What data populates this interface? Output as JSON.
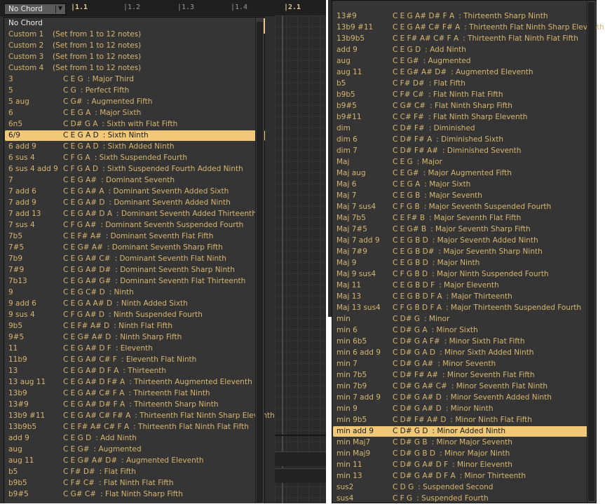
{
  "toolbar": {
    "chord_select_value": "No Chord",
    "ruler": [
      "|1.1",
      "|1.2",
      "|1.3",
      "|1.4",
      "|2.1"
    ]
  },
  "left_menu": {
    "items": [
      {
        "name": "No Chord",
        "notes": "",
        "desc": ""
      },
      {
        "name": "Custom 1",
        "notes": "(Set from 1 to 12 notes)",
        "desc": ""
      },
      {
        "name": "Custom 2",
        "notes": "(Set from 1 to 12 notes)",
        "desc": ""
      },
      {
        "name": "Custom 3",
        "notes": "(Set from 1 to 12 notes)",
        "desc": ""
      },
      {
        "name": "Custom 4",
        "notes": "(Set from 1 to 12 notes)",
        "desc": ""
      },
      {
        "name": "3",
        "notes": "C E G",
        "desc": ": Major Third"
      },
      {
        "name": "5",
        "notes": "C G",
        "desc": ": Perfect Fifth"
      },
      {
        "name": "5 aug",
        "notes": "C G#",
        "desc": ": Augmented Fifth"
      },
      {
        "name": "6",
        "notes": "C E G A",
        "desc": ": Major Sixth"
      },
      {
        "name": "6n5",
        "notes": "C D# G A",
        "desc": ": Sixth with Flat Fifth"
      },
      {
        "name": "6/9",
        "notes": "C E G A D",
        "desc": ": Sixth Ninth"
      },
      {
        "name": "6 add 9",
        "notes": "C E G A D",
        "desc": ": Sixth Added Ninth"
      },
      {
        "name": "6 sus 4",
        "notes": "C F G A",
        "desc": ": Sixth Suspended Fourth"
      },
      {
        "name": "6 sus 4 add 9",
        "notes": "C F G A D",
        "desc": ": Sixth Suspended Fourth Added Ninth"
      },
      {
        "name": "7",
        "notes": "C E G A#",
        "desc": ": Dominant Seventh"
      },
      {
        "name": "7 add 6",
        "notes": "C E G A# A",
        "desc": ": Dominant Seventh Added Sixth"
      },
      {
        "name": "7 add 9",
        "notes": "C E G A# D",
        "desc": ": Dominant Seventh Added Ninth"
      },
      {
        "name": "7 add 13",
        "notes": "C E G A# D A",
        "desc": ": Dominant Seventh Added Thirteenth"
      },
      {
        "name": "7 sus 4",
        "notes": "C F G A#",
        "desc": ": Dominant Seventh Suspended Fourth"
      },
      {
        "name": "7b5",
        "notes": "C E F# A#",
        "desc": ": Dominant Seventh Flat Fifth"
      },
      {
        "name": "7#5",
        "notes": "C E G# A#",
        "desc": ": Dominant Seventh Sharp Fifth"
      },
      {
        "name": "7b9",
        "notes": "C E G A# C#",
        "desc": ": Dominant Seventh Flat Ninth"
      },
      {
        "name": "7#9",
        "notes": "C E G A# D#",
        "desc": ": Dominant Seventh Sharp Ninth"
      },
      {
        "name": "7b13",
        "notes": "C E G A# G#",
        "desc": ": Dominant Seventh Flat Thirteenth"
      },
      {
        "name": "9",
        "notes": "C E G C# D",
        "desc": ": Ninth"
      },
      {
        "name": "9 add 6",
        "notes": "C E G A A# D",
        "desc": ": Ninth Added Sixth"
      },
      {
        "name": "9 sus 4",
        "notes": "C F G A# D",
        "desc": ": Ninth Suspended Fourth"
      },
      {
        "name": "9b5",
        "notes": "C E F# A# D",
        "desc": ": Ninth Flat Fifth"
      },
      {
        "name": "9#5",
        "notes": "C E G# A# D",
        "desc": ": Ninth Sharp Fifth"
      },
      {
        "name": "11",
        "notes": "C E G A# D F",
        "desc": ": Eleventh"
      },
      {
        "name": "11b9",
        "notes": "C E G A# C# F",
        "desc": ": Eleventh Flat Ninth"
      },
      {
        "name": "13",
        "notes": "C E G A# D F A",
        "desc": ": Thirteenth"
      },
      {
        "name": "13 aug 11",
        "notes": "C E G A# D F# A",
        "desc": ": Thirteenth Augmented Eleventh"
      },
      {
        "name": "13b9",
        "notes": "C E G A# C# F A",
        "desc": ": Thirteenth Flat Ninth"
      },
      {
        "name": "13#9",
        "notes": "C E G A# D# F A",
        "desc": ": Thirteenth Sharp Ninth"
      },
      {
        "name": "13b9 #11",
        "notes": "C E G A# C# F# A",
        "desc": ": Thirteenth Flat Ninth Sharp Eleventh"
      },
      {
        "name": "13b9b5",
        "notes": "C E F# A# C# F A",
        "desc": ": Thirteenth Flat Ninth Flat Fifth"
      },
      {
        "name": "add 9",
        "notes": "C E G D",
        "desc": ": Add Ninth"
      },
      {
        "name": "aug",
        "notes": "C E G#",
        "desc": ": Augmented"
      },
      {
        "name": "aug 11",
        "notes": "C E G# A# D#",
        "desc": ": Augmented Eleventh"
      },
      {
        "name": "b5",
        "notes": "C F# D#",
        "desc": ": Flat Fifth"
      },
      {
        "name": "b9b5",
        "notes": "C F# C#",
        "desc": ": Flat Ninth Flat Fifth"
      },
      {
        "name": "b9#5",
        "notes": "C G# C#",
        "desc": ": Flat Ninth Sharp Fifth"
      }
    ]
  },
  "right_menu": {
    "items": [
      {
        "name": "13#9",
        "notes": "C E G A# D# F A",
        "desc": ": Thirteenth Sharp Ninth"
      },
      {
        "name": "13b9 #11",
        "notes": "C E G A# C# F# A",
        "desc": ": Thirteenth Flat Ninth Sharp Eleventh"
      },
      {
        "name": "13b9b5",
        "notes": "C E F# A# C# F A",
        "desc": ": Thirteenth Flat Ninth Flat Fifth"
      },
      {
        "name": "add 9",
        "notes": "C E G D",
        "desc": ": Add Ninth"
      },
      {
        "name": "aug",
        "notes": "C E G#",
        "desc": ": Augmented"
      },
      {
        "name": "aug 11",
        "notes": "C E G# A# D#",
        "desc": ": Augmented Eleventh"
      },
      {
        "name": "b5",
        "notes": "C F# D#",
        "desc": ": Flat Fifth"
      },
      {
        "name": "b9b5",
        "notes": "C F# C#",
        "desc": ": Flat Ninth Flat Fifth"
      },
      {
        "name": "b9#5",
        "notes": "C G# C#",
        "desc": ": Flat Ninth Sharp Fifth"
      },
      {
        "name": "b9#11",
        "notes": "C C# F#",
        "desc": ": Flat Ninth Sharp Eleventh"
      },
      {
        "name": "dim",
        "notes": "C D# F#",
        "desc": ": Diminished"
      },
      {
        "name": "dim 6",
        "notes": "C D# F# A",
        "desc": ": Diminished Sixth"
      },
      {
        "name": "dim 7",
        "notes": "C D# F# A#",
        "desc": ": Diminished Seventh"
      },
      {
        "name": "Maj",
        "notes": "C E G",
        "desc": ": Major"
      },
      {
        "name": "Maj aug",
        "notes": "C E G#",
        "desc": ": Major Augmented Fifth"
      },
      {
        "name": "Maj 6",
        "notes": "C E G A",
        "desc": ": Major Sixth"
      },
      {
        "name": "Maj 7",
        "notes": "C E G B",
        "desc": ": Major Seventh"
      },
      {
        "name": "Maj 7 sus4",
        "notes": "C F G B",
        "desc": ": Major Seventh Suspended Fourth"
      },
      {
        "name": "Maj 7b5",
        "notes": "C E F# B",
        "desc": ": Major Seventh Flat Fifth"
      },
      {
        "name": "Maj 7#5",
        "notes": "C E G# B",
        "desc": ": Major Seventh Sharp Fifth"
      },
      {
        "name": "Maj 7 add 9",
        "notes": "C E G B D",
        "desc": ": Major Seventh Added Ninth"
      },
      {
        "name": "Maj 7#9",
        "notes": "C E G B D#",
        "desc": ": Major Seventh Sharp Ninth"
      },
      {
        "name": "Maj 9",
        "notes": "C E G B D",
        "desc": ": Major Ninth"
      },
      {
        "name": "Maj 9 sus4",
        "notes": "C F G B D",
        "desc": ": Major Ninth Suspended Fourth"
      },
      {
        "name": "Maj 11",
        "notes": "C E G B D F",
        "desc": ": Major Eleventh"
      },
      {
        "name": "Maj 13",
        "notes": "C E G B D F A",
        "desc": ": Major Thirteenth"
      },
      {
        "name": "Maj 13 sus4",
        "notes": "C F G B D F A",
        "desc": ": Major Thirteenth Suspended Fourth"
      },
      {
        "name": "min",
        "notes": "C D# G",
        "desc": ": Minor"
      },
      {
        "name": "min 6",
        "notes": "C D# G A",
        "desc": ": Minor Sixth"
      },
      {
        "name": "min 6b5",
        "notes": "C D# G A F#",
        "desc": ": Minor Sixth Flat Fifth"
      },
      {
        "name": "min 6 add 9",
        "notes": "C D# G A D",
        "desc": ": Minor Sixth Added Ninth"
      },
      {
        "name": "min 7",
        "notes": "C D# G A#",
        "desc": ": Minor Seventh"
      },
      {
        "name": "min 7b5",
        "notes": "C D# F# A#",
        "desc": ": Minor Seventh Flat Fifth"
      },
      {
        "name": "min 7b9",
        "notes": "C D# G A# C#",
        "desc": ": Minor Seventh Flat Ninth"
      },
      {
        "name": "min 7 add 9",
        "notes": "C D# G A# D",
        "desc": ": Minor Seventh Added Ninth"
      },
      {
        "name": "min 9",
        "notes": "C D# G A# D",
        "desc": ": Minor Ninth"
      },
      {
        "name": "min 9b5",
        "notes": "C D# F# A# D",
        "desc": ": Minor Ninth Flat Fifth"
      },
      {
        "name": "min add 9",
        "notes": "C D# G D",
        "desc": ": Minor Added Ninth"
      },
      {
        "name": "min Maj7",
        "notes": "C D# G B",
        "desc": ": Minor Major Seventh"
      },
      {
        "name": "min Maj9",
        "notes": "C D# G B D",
        "desc": ": Minor Major Ninth"
      },
      {
        "name": "min 11",
        "notes": "C D# G A# D F",
        "desc": ": Minor Eleventh"
      },
      {
        "name": "min 13",
        "notes": "C D# G A# D F A",
        "desc": ": Minor Thirteenth"
      },
      {
        "name": "sus2",
        "notes": "C D G",
        "desc": ": Suspended Second"
      },
      {
        "name": "sus4",
        "notes": "C F G",
        "desc": ": Suspended Fourth"
      }
    ]
  },
  "colors": {
    "menu_text": "#d8b56f",
    "selected_bg": "#f0c878",
    "menu_bg": "#353535",
    "app_bg": "#2e2e2e"
  }
}
